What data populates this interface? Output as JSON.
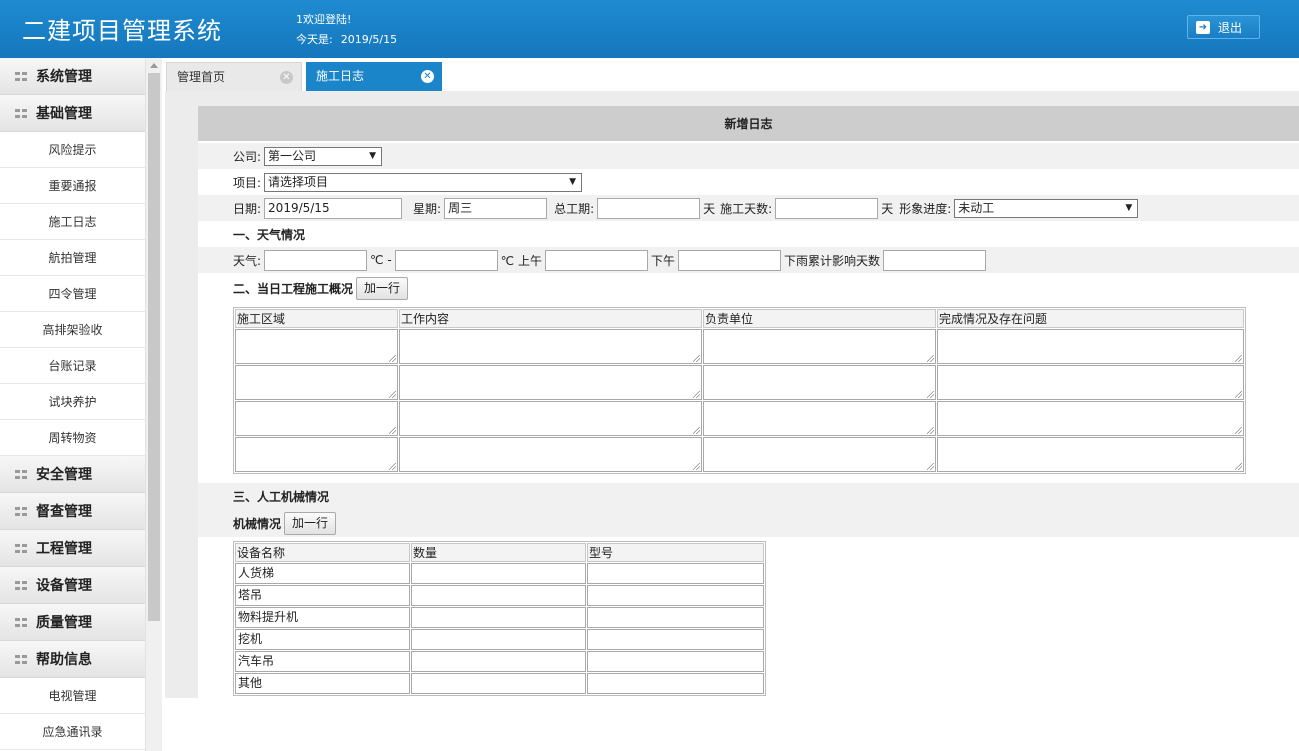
{
  "header": {
    "app_title": "二建项目管理系统",
    "welcome": "1欢迎登陆!",
    "today_label": "今天是:",
    "today_date": "2019/5/15",
    "logout_label": "退出",
    "logout_icon": "logout-icon"
  },
  "sidebar": {
    "groups": [
      {
        "label": "系统管理"
      },
      {
        "label": "基础管理",
        "items": [
          "风险提示",
          "重要通报",
          "施工日志",
          "航拍管理",
          "四令管理",
          "高排架验收",
          "台账记录",
          "试块养护",
          "周转物资"
        ]
      },
      {
        "label": "安全管理"
      },
      {
        "label": "督查管理"
      },
      {
        "label": "工程管理"
      },
      {
        "label": "设备管理"
      },
      {
        "label": "质量管理"
      },
      {
        "label": "帮助信息",
        "items": [
          "电视管理",
          "应急通讯录"
        ]
      }
    ]
  },
  "tabs": [
    {
      "label": "管理首页",
      "active": false
    },
    {
      "label": "施工日志",
      "active": true
    }
  ],
  "form": {
    "title": "新增日志",
    "company_label": "公司:",
    "company_value": "第一公司",
    "project_label": "项目:",
    "project_value": "请选择项目",
    "date_label": "日期:",
    "date_value": "2019/5/15",
    "weekday_label": "星期:",
    "weekday_value": "周三",
    "total_period_label": "总工期:",
    "day_unit": "天",
    "construction_days_label": "施工天数:",
    "progress_label": "形象进度:",
    "progress_value": "未动工",
    "weather_section": "一、天气情况",
    "weather_label": "天气:",
    "temp_unit_dash": "℃ -",
    "temp_unit_morning": "℃ 上午",
    "afternoon_label": "下午",
    "rain_days_label": "下雨累计影响天数",
    "work_section": "二、当日工程施工概况",
    "add_row": "加一行",
    "work_columns": [
      "施工区域",
      "工作内容",
      "负责单位",
      "完成情况及存在问题"
    ],
    "labor_section": "三、人工机械情况",
    "machinery_label": "机械情况",
    "machinery_columns": [
      "设备名称",
      "数量",
      "型号"
    ],
    "machinery_rows": [
      "人货梯",
      "塔吊",
      "物料提升机",
      "挖机",
      "汽车吊",
      "其他"
    ]
  }
}
